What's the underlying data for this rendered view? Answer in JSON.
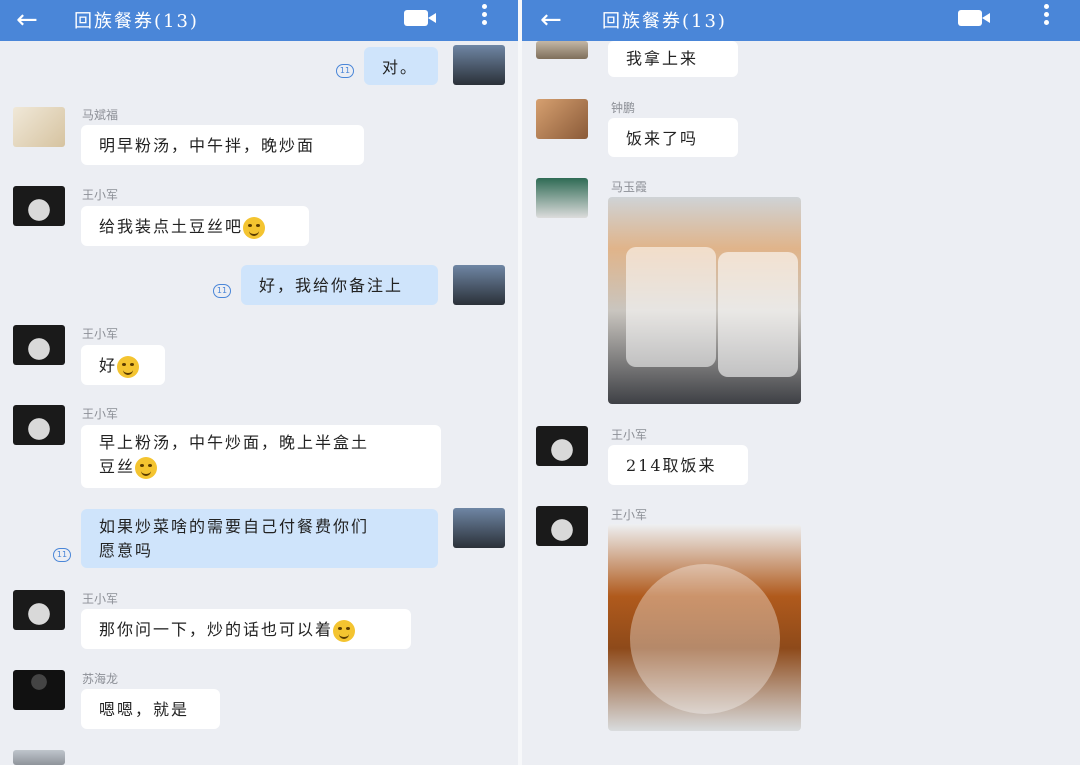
{
  "chat_title": "回族餐券(13)",
  "left": {
    "messages": [
      {
        "sender": "",
        "text": "对。",
        "mine": true
      },
      {
        "sender": "马斌福",
        "text": "明早粉汤，中午拌，晚炒面"
      },
      {
        "sender": "王小军",
        "text": "给我装点土豆丝吧"
      },
      {
        "sender": "",
        "text": "好，我给你备注上",
        "mine": true
      },
      {
        "sender": "王小军",
        "text": "好"
      },
      {
        "sender": "王小军",
        "text_line1": "早上粉汤，中午炒面，晚上半盒土",
        "text_line2": "豆丝"
      },
      {
        "sender": "",
        "text_line1": "如果炒菜啥的需要自己付餐费你们",
        "text_line2": "愿意吗",
        "mine": true
      },
      {
        "sender": "王小军",
        "text": "那你问一下，炒的话也可以着"
      },
      {
        "sender": "苏海龙",
        "text": "嗯嗯，就是"
      }
    ],
    "read_mark": "11"
  },
  "right": {
    "messages": [
      {
        "sender": "",
        "text": "我拿上来"
      },
      {
        "sender": "钟鹏",
        "text": "饭来了吗"
      },
      {
        "sender": "马玉霞",
        "text": ""
      },
      {
        "sender": "王小军",
        "text": "214取饭来"
      },
      {
        "sender": "王小军",
        "text": ""
      }
    ]
  },
  "colors": {
    "topbar": "#4a86d8",
    "mine_bubble": "#cfe4fb",
    "other_bubble": "#ffffff"
  },
  "icons": [
    "back-arrow-icon",
    "video-call-icon",
    "more-menu-icon",
    "read-receipt-icon"
  ]
}
